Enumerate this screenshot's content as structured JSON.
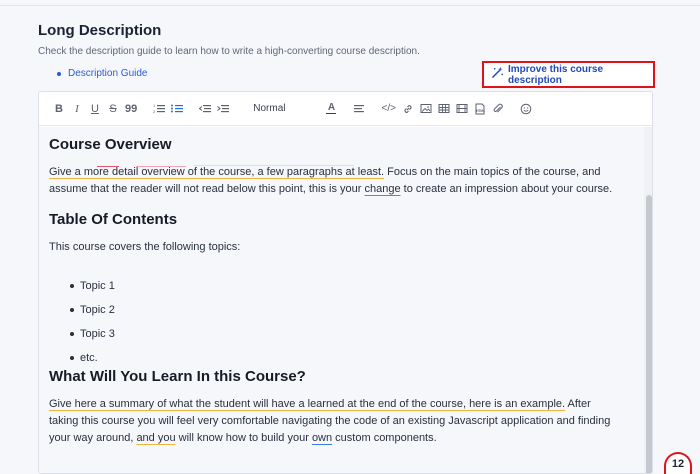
{
  "section": {
    "title": "Long Description",
    "subtitle": "Check the description guide to learn how to write a high-converting course description.",
    "guide_link": "Description Guide",
    "improve_button": "Improve this course description"
  },
  "toolbar": {
    "items": [
      "B",
      "I",
      "U",
      "S",
      "99",
      "ordered-list",
      "bullet-list",
      "outdent",
      "indent",
      "Normal",
      "A",
      "align",
      "code",
      "link",
      "image",
      "table",
      "video",
      "html",
      "attachment",
      "emoji"
    ],
    "format_select": "Normal"
  },
  "content": {
    "h_overview": "Course Overview",
    "p_overview_1": "Give a more detail overview of the course, a few paragraphs at least.",
    "p_overview_2": " Focus on the main topics of the course, and assume that the reader will not read below this point, this is your ",
    "p_overview_3": "change",
    "p_overview_4": " to create an impression about your course.",
    "h_toc": "Table Of Contents",
    "p_toc": "This course covers the following topics:",
    "topics": [
      "Topic 1",
      "Topic 2",
      "Topic 3",
      "etc."
    ],
    "h_learn": "What Will You Learn In this Course?",
    "p_learn_1": "Give here a summary of what the student will have a learned at the end of the course, here is an example.",
    "p_learn_2": " After taking this course you will feel very comfortable navigating the code of an existing Javascript application and finding your way around, ",
    "p_learn_3": "and you",
    "p_learn_4": " will know how to build your ",
    "p_learn_5": "own",
    "p_learn_6": " custom components."
  },
  "badge": {
    "count": "12"
  },
  "colors": {
    "accent": "#2a5bd7",
    "highlight_border": "#e0121b"
  }
}
